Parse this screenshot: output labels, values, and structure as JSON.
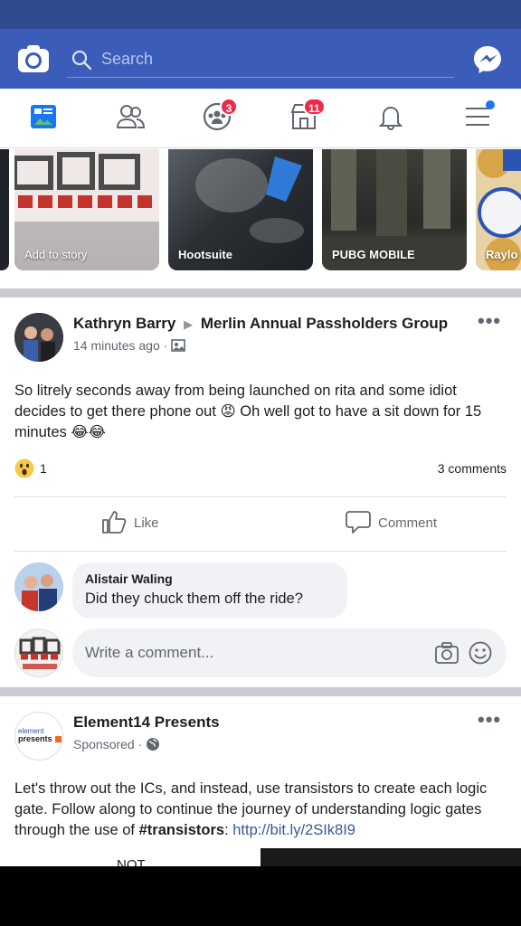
{
  "colors": {
    "brand": "#3b5cb8",
    "status_bar": "#2f4b8e",
    "badge": "#f02849",
    "link": "#385898",
    "divider": "#c9ccd1"
  },
  "header": {
    "search_placeholder": "Search",
    "camera_icon": "camera-icon",
    "messenger_icon": "messenger-icon"
  },
  "nav": {
    "items": [
      {
        "icon": "news-feed-icon",
        "active": true
      },
      {
        "icon": "friends-icon"
      },
      {
        "icon": "groups-icon",
        "badge": "3"
      },
      {
        "icon": "marketplace-icon",
        "badge": "11"
      },
      {
        "icon": "notifications-icon"
      },
      {
        "icon": "menu-icon"
      }
    ]
  },
  "stories": [
    {
      "label": "Add to story"
    },
    {
      "label": "Hootsuite"
    },
    {
      "label": "PUBG MOBILE"
    },
    {
      "label": "Raylo"
    }
  ],
  "post1": {
    "author": "Kathryn Barry",
    "group": "Merlin Annual Passholders Group",
    "time": "14 minutes ago",
    "text": "So litrely seconds away from being launched on rita and some idiot decides to get there phone out 😡 Oh well got to have a sit down for 15 minutes 😂😂",
    "reaction_count": "1",
    "comments": "3 comments",
    "like_label": "Like",
    "comment_label": "Comment",
    "top_comment": {
      "author": "Alistair Waling",
      "text": "Did they chuck them off the ride?"
    },
    "comment_placeholder": "Write a comment..."
  },
  "post2": {
    "author": "Element14 Presents",
    "sponsored": "Sponsored",
    "text_main": "Let's throw out the ICs, and instead, use transistors to create each logic gate. Follow along to continue the journey of understanding logic gates through the use of ",
    "hashtag": "#transistors",
    "text_sep": ": ",
    "link": "http://bit.ly/2SIk8I9",
    "image_caption": "NOT",
    "avatar_text": "presents"
  }
}
